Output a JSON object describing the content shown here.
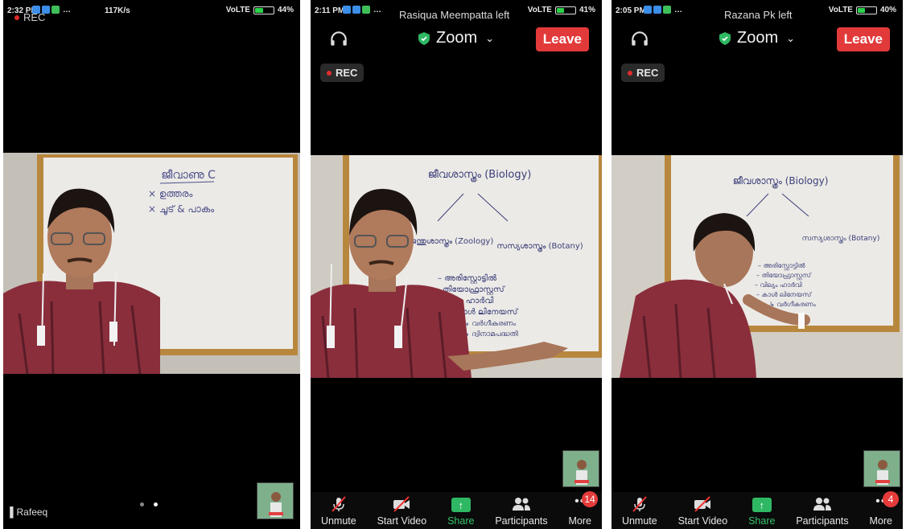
{
  "screens": [
    {
      "status": {
        "time": "2:32 PM",
        "net": "117K/s",
        "network_label": "VoLTE",
        "battery": "44%",
        "battery_level": 0.44
      },
      "rec_label": "REC",
      "video": {
        "board_title": "ജീവാണു C",
        "board_lines": [
          "× ഉത്തരം",
          "× ചൂട് & പാകം"
        ]
      },
      "participant_name": "Rafeeq",
      "page_dots": 2,
      "active_page": 2
    },
    {
      "status": {
        "time": "2:11 PM",
        "network_label": "VoLTE",
        "battery": "41%",
        "battery_level": 0.41
      },
      "notification": "Rasiqua Meempatta left",
      "meeting_title": "Zoom",
      "leave_label": "Leave",
      "rec_label": "REC",
      "video": {
        "board_title": "ജീവശാസ്ത്രം (Biology)",
        "left_branch": "ജന്തുശാസ്ത്രം (Zoology)",
        "right_branch": "സസ്യശാസ്ത്രം (Botany)",
        "lines": [
          "– അരിസ്റ്റോട്ടിൽ",
          "– തിയോഫ്രാസ്റ്റസ്",
          "– വില്യം ഹാർവി",
          "– കാൾ ലിനേയസ്",
          "↳ വർഗീകരണം",
          "↳ ദ്വിനാമപദ്ധതി"
        ]
      },
      "toolbar": [
        {
          "label": "Unmute",
          "icon": "mic-muted-icon"
        },
        {
          "label": "Start Video",
          "icon": "video-off-icon"
        },
        {
          "label": "Share",
          "icon": "share-icon"
        },
        {
          "label": "Participants",
          "icon": "participants-icon"
        },
        {
          "label": "More",
          "icon": "more-icon",
          "badge": "14"
        }
      ]
    },
    {
      "status": {
        "time": "2:05 PM",
        "network_label": "VoLTE",
        "battery": "40%",
        "battery_level": 0.4
      },
      "notification": "Razana Pk left",
      "meeting_title": "Zoom",
      "leave_label": "Leave",
      "rec_label": "REC",
      "video": {
        "board_title": "ജീവശാസ്ത്രം (Biology)",
        "right_branch": "സസ്യശാസ്ത്രം (Botany)",
        "lines": [
          "– അരിസ്റ്റോട്ടിൽ",
          "– തിയോഫ്രാസ്റ്റസ്",
          "– വില്യം ഹാർവി",
          "– കാൾ ലിനേയസ്",
          "↳ വർഗീകരണം"
        ]
      },
      "toolbar": [
        {
          "label": "Unmute",
          "icon": "mic-muted-icon"
        },
        {
          "label": "Start Video",
          "icon": "video-off-icon"
        },
        {
          "label": "Share",
          "icon": "share-icon"
        },
        {
          "label": "Participants",
          "icon": "participants-icon"
        },
        {
          "label": "More",
          "icon": "more-icon",
          "badge": "4"
        }
      ]
    }
  ],
  "colors": {
    "leave": "#e23a3a",
    "share": "#2fb864",
    "shield": "#2fb864",
    "rec_dot": "#e02b2b",
    "badge": "#e53b3b",
    "battery": "#2bd14a"
  }
}
